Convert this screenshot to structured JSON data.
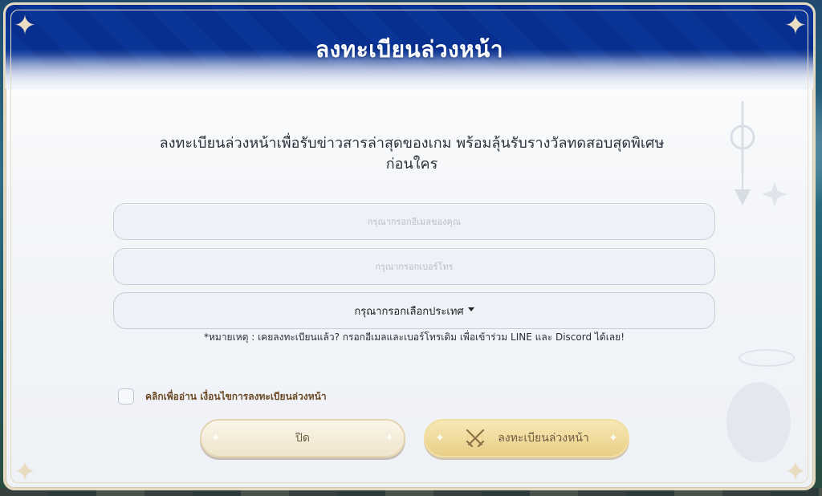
{
  "modal": {
    "title": "ลงทะเบียนล่วงหน้า",
    "subtitle_line1": "ลงทะเบียนล่วงหน้าเพื่อรับข่าวสารล่าสุดของเกม พร้อมลุ้นรับรางวัลทดสอบสุดพิเศษ",
    "subtitle_line2": "ก่อนใคร"
  },
  "form": {
    "email_placeholder": "กรุณากรอกอีเมลของคุณ",
    "phone_placeholder": "กรุณากรอกเบอร์โทร",
    "country_select_label": "กรุณากรอกเลือกประเทศ",
    "note": "*หมายเหตุ : เคยลงทะเบียนแล้ว? กรอกอีเมลและเบอร์โทรเดิม เพื่อเข้าร่วม LINE และ Discord ได้เลย!",
    "terms_label": "คลิกเพื่ออ่าน เงื่อนไขการลงทะเบียนล่วงหน้า",
    "terms_checked": false
  },
  "buttons": {
    "close_label": "ปิด",
    "register_label": "ลงทะเบียนล่วงหน้า",
    "register_icon": "crossed-swords-icon"
  },
  "colors": {
    "header_blue": "#2f6fc1",
    "frame_gold": "#e6dcc4",
    "register_button": "#e9cf86",
    "close_button": "#efe4cc",
    "terms_text": "#6b4a24"
  }
}
